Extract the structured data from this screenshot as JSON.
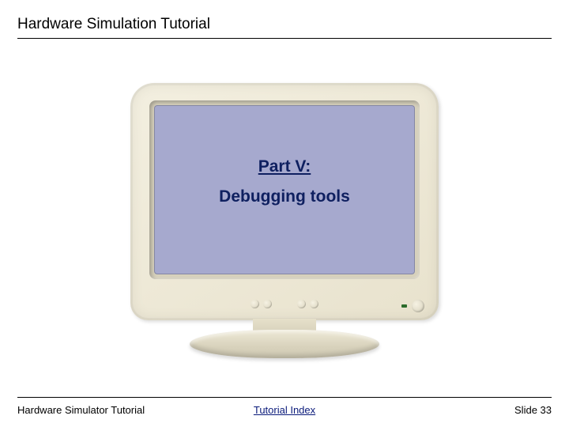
{
  "header": {
    "title": "Hardware Simulation Tutorial"
  },
  "screen": {
    "part_label": "Part V:",
    "subtitle": "Debugging tools"
  },
  "footer": {
    "left": "Hardware Simulator Tutorial",
    "center": "Tutorial Index",
    "right": "Slide 33"
  }
}
